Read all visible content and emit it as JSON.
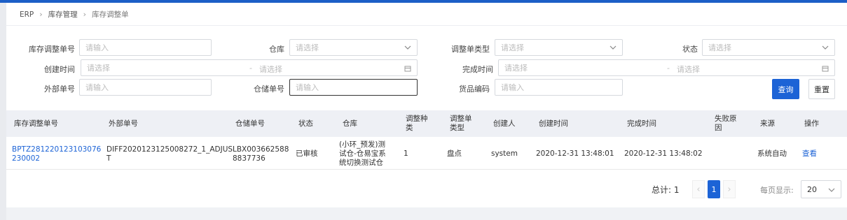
{
  "breadcrumb": {
    "root": "ERP",
    "level1": "库存管理",
    "current": "库存调整单"
  },
  "filters": {
    "adjust_no": {
      "label": "库存调整单号",
      "placeholder": "请输入"
    },
    "warehouse": {
      "label": "仓库",
      "placeholder": "请选择"
    },
    "adjust_type": {
      "label": "调整单类型",
      "placeholder": "请选择"
    },
    "status": {
      "label": "状态",
      "placeholder": "请选择"
    },
    "created_time": {
      "label": "创建时间",
      "start_placeholder": "请选择",
      "end_placeholder": "请选择",
      "separator": "-"
    },
    "finished_time": {
      "label": "完成时间",
      "start_placeholder": "请选择",
      "end_placeholder": "请选择",
      "separator": "-"
    },
    "external_no": {
      "label": "外部单号",
      "placeholder": "请输入"
    },
    "storage_no": {
      "label": "仓储单号",
      "placeholder": "请输入"
    },
    "sku_code": {
      "label": "货品编码",
      "placeholder": "请输入"
    }
  },
  "buttons": {
    "query": "查询",
    "reset": "重置"
  },
  "table": {
    "headers": {
      "adjust_no": "库存调整单号",
      "external_no": "外部单号",
      "storage_no": "仓储单号",
      "status": "状态",
      "warehouse": "仓库",
      "adjust_qty_l1": "调整种",
      "adjust_qty_l2": "类",
      "adjust_type_l1": "调整单",
      "adjust_type_l2": "类型",
      "creator": "创建人",
      "created_time": "创建时间",
      "finished_time": "完成时间",
      "fail_reason_l1": "失败原",
      "fail_reason_l2": "因",
      "source": "来源",
      "action": "操作"
    },
    "rows": [
      {
        "adjust_no_l1": "BPTZ281220123103076",
        "adjust_no_l2": "230002",
        "external_no_l1": "DIFF2020123125008272_1_ADJUS",
        "external_no_l2": "T",
        "storage_no_l1": "LBX003662588",
        "storage_no_l2": "8837736",
        "status": "已审核",
        "warehouse_l1": "(小环_预发)测",
        "warehouse_l2": "试仓-仓易宝系",
        "warehouse_l3": "统切换测试仓",
        "adjust_qty": "1",
        "adjust_type": "盘点",
        "creator": "system",
        "created_time": "2020-12-31 13:48:01",
        "finished_time": "2020-12-31 13:48:02",
        "fail_reason": "",
        "source": "系统自动",
        "action": "查看"
      }
    ]
  },
  "pagination": {
    "total_label": "总计: 1",
    "current_page": "1",
    "page_size_label": "每页显示:",
    "page_size": "20"
  },
  "colors": {
    "primary": "#1c63d6",
    "topbar": "#1c5fc7",
    "header_bg": "#eef0f5"
  }
}
